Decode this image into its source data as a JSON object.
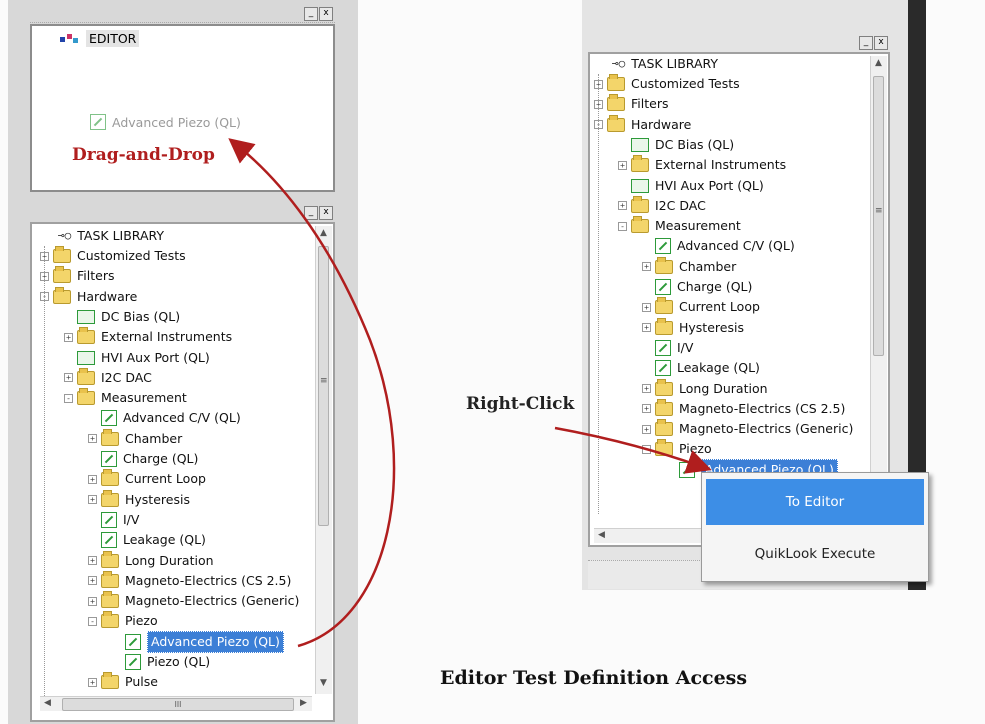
{
  "colors": {
    "annotation_red": "#b01e1e",
    "selection_blue": "#3c7fd6",
    "menu_highlight": "#3d8ee6",
    "test_icon_green": "#2d9a3a",
    "folder_yellow": "#f3d56a"
  },
  "left_panel": {
    "editor": {
      "title": "EDITOR",
      "item": "Advanced Piezo (QL)"
    },
    "library": {
      "title": "TASK LIBRARY",
      "items": [
        {
          "label": "Customized Tests",
          "icon": "folder-icon",
          "expander": "+"
        },
        {
          "label": "Filters",
          "icon": "folder-icon",
          "expander": "+"
        },
        {
          "label": "Hardware",
          "icon": "folder-icon",
          "expander": "-"
        },
        {
          "label": "DC Bias (QL)",
          "icon": "hardware-icon",
          "expander": ""
        },
        {
          "label": "External Instruments",
          "icon": "folder-icon",
          "expander": "+"
        },
        {
          "label": "HVI Aux Port (QL)",
          "icon": "hardware-icon",
          "expander": ""
        },
        {
          "label": "I2C DAC",
          "icon": "folder-icon",
          "expander": "+"
        },
        {
          "label": "Measurement",
          "icon": "folder-icon",
          "expander": "-"
        },
        {
          "label": "Advanced C/V (QL)",
          "icon": "test-icon",
          "expander": ""
        },
        {
          "label": "Chamber",
          "icon": "folder-icon",
          "expander": "+"
        },
        {
          "label": "Charge (QL)",
          "icon": "test-icon",
          "expander": ""
        },
        {
          "label": "Current Loop",
          "icon": "folder-icon",
          "expander": "+"
        },
        {
          "label": "Hysteresis",
          "icon": "folder-icon",
          "expander": "+"
        },
        {
          "label": "I/V",
          "icon": "test-icon",
          "expander": ""
        },
        {
          "label": "Leakage (QL)",
          "icon": "test-icon",
          "expander": ""
        },
        {
          "label": "Long Duration",
          "icon": "folder-icon",
          "expander": "+"
        },
        {
          "label": "Magneto-Electrics (CS 2.5)",
          "icon": "folder-icon",
          "expander": "+"
        },
        {
          "label": "Magneto-Electrics (Generic)",
          "icon": "folder-icon",
          "expander": "+"
        },
        {
          "label": "Piezo",
          "icon": "folder-icon",
          "expander": "-"
        },
        {
          "label": "Advanced Piezo (QL)",
          "icon": "test-icon",
          "expander": "",
          "selected": true
        },
        {
          "label": "Piezo (QL)",
          "icon": "test-icon",
          "expander": ""
        },
        {
          "label": "Pulse",
          "icon": "folder-icon",
          "expander": "+"
        }
      ],
      "scrollbar_h_label": "III"
    }
  },
  "right_panel": {
    "library": {
      "title": "TASK LIBRARY",
      "items": [
        {
          "label": "Customized Tests",
          "icon": "folder-icon",
          "expander": "+"
        },
        {
          "label": "Filters",
          "icon": "folder-icon",
          "expander": "+"
        },
        {
          "label": "Hardware",
          "icon": "folder-icon",
          "expander": "-"
        },
        {
          "label": "DC Bias (QL)",
          "icon": "hardware-icon",
          "expander": ""
        },
        {
          "label": "External Instruments",
          "icon": "folder-icon",
          "expander": "+"
        },
        {
          "label": "HVI Aux Port (QL)",
          "icon": "hardware-icon",
          "expander": ""
        },
        {
          "label": "I2C DAC",
          "icon": "folder-icon",
          "expander": "+"
        },
        {
          "label": "Measurement",
          "icon": "folder-icon",
          "expander": "-"
        },
        {
          "label": "Advanced C/V (QL)",
          "icon": "test-icon",
          "expander": ""
        },
        {
          "label": "Chamber",
          "icon": "folder-icon",
          "expander": "+"
        },
        {
          "label": "Charge (QL)",
          "icon": "test-icon",
          "expander": ""
        },
        {
          "label": "Current Loop",
          "icon": "folder-icon",
          "expander": "+"
        },
        {
          "label": "Hysteresis",
          "icon": "folder-icon",
          "expander": "+"
        },
        {
          "label": "I/V",
          "icon": "test-icon",
          "expander": ""
        },
        {
          "label": "Leakage (QL)",
          "icon": "test-icon",
          "expander": ""
        },
        {
          "label": "Long Duration",
          "icon": "folder-icon",
          "expander": "+"
        },
        {
          "label": "Magneto-Electrics (CS 2.5)",
          "icon": "folder-icon",
          "expander": "+"
        },
        {
          "label": "Magneto-Electrics (Generic)",
          "icon": "folder-icon",
          "expander": "+"
        },
        {
          "label": "Piezo",
          "icon": "folder-icon",
          "expander": "-"
        },
        {
          "label": "Advanced Piezo (QL)",
          "icon": "test-icon",
          "expander": "",
          "selected": true
        }
      ]
    },
    "context_menu": {
      "items": [
        "To Editor",
        "QuikLook Execute"
      ]
    }
  },
  "annotations": {
    "drag_and_drop": "Drag-and-Drop",
    "right_click": "Right-Click",
    "caption": "Editor Test Definition Access"
  },
  "window_buttons": {
    "minimize": "_",
    "close": "x"
  }
}
